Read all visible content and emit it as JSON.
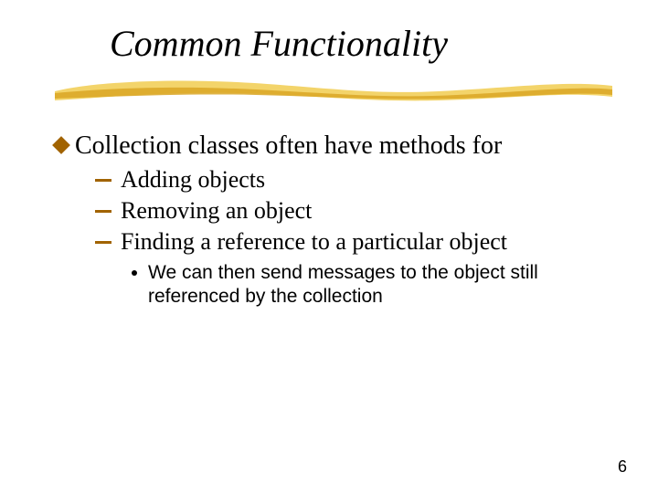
{
  "title": "Common Functionality",
  "bullets": {
    "lvl1": "Collection classes often have methods for",
    "lvl2": [
      "Adding objects",
      "Removing an object",
      "Finding a reference to a particular object"
    ],
    "lvl3": [
      "We can then send messages to the object still referenced by the collection"
    ]
  },
  "page_number": "6",
  "colors": {
    "accent": "#a16300",
    "brush_light": "#f3d46a",
    "brush_dark": "#d9a624"
  }
}
